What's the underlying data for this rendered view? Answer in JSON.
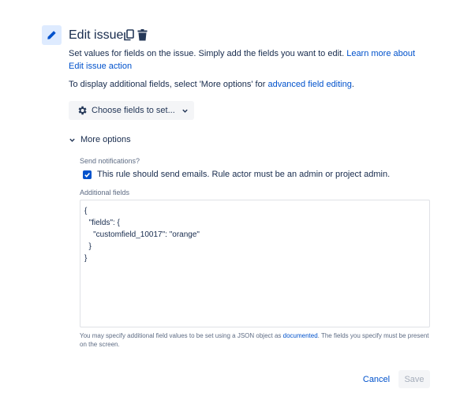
{
  "header": {
    "title": "Edit issue",
    "icons": [
      "pencil-icon",
      "copy-icon",
      "trash-icon"
    ]
  },
  "description": {
    "text": "Set values for fields on the issue. Simply add the fields you want to edit. ",
    "link": "Learn more about Edit issue action"
  },
  "additional_info": {
    "text": "To display additional fields, select 'More options' for ",
    "link": "advanced field editing",
    "suffix": "."
  },
  "choose_fields": {
    "label": "Choose fields to set..."
  },
  "more_options": {
    "label": "More options"
  },
  "notifications": {
    "label": "Send notifications?",
    "checkbox_label": "This rule should send emails. Rule actor must be an admin or project admin.",
    "checked": true
  },
  "additional_fields": {
    "label": "Additional fields",
    "value": "{\n  \"fields\": {\n    \"customfield_10017\": \"orange\"\n  }\n}",
    "help_text": "You may specify additional field values to be set using a JSON object as ",
    "help_link": "documented",
    "help_suffix": ". The fields you specify must be present on the screen."
  },
  "actions": {
    "cancel_label": "Cancel",
    "save_label": "Save"
  },
  "colors": {
    "accent": "#0052cc",
    "icon_bg": "#deebff",
    "text": "#172b4d",
    "subtle": "#5e6c84",
    "disabled": "#a5adba"
  }
}
